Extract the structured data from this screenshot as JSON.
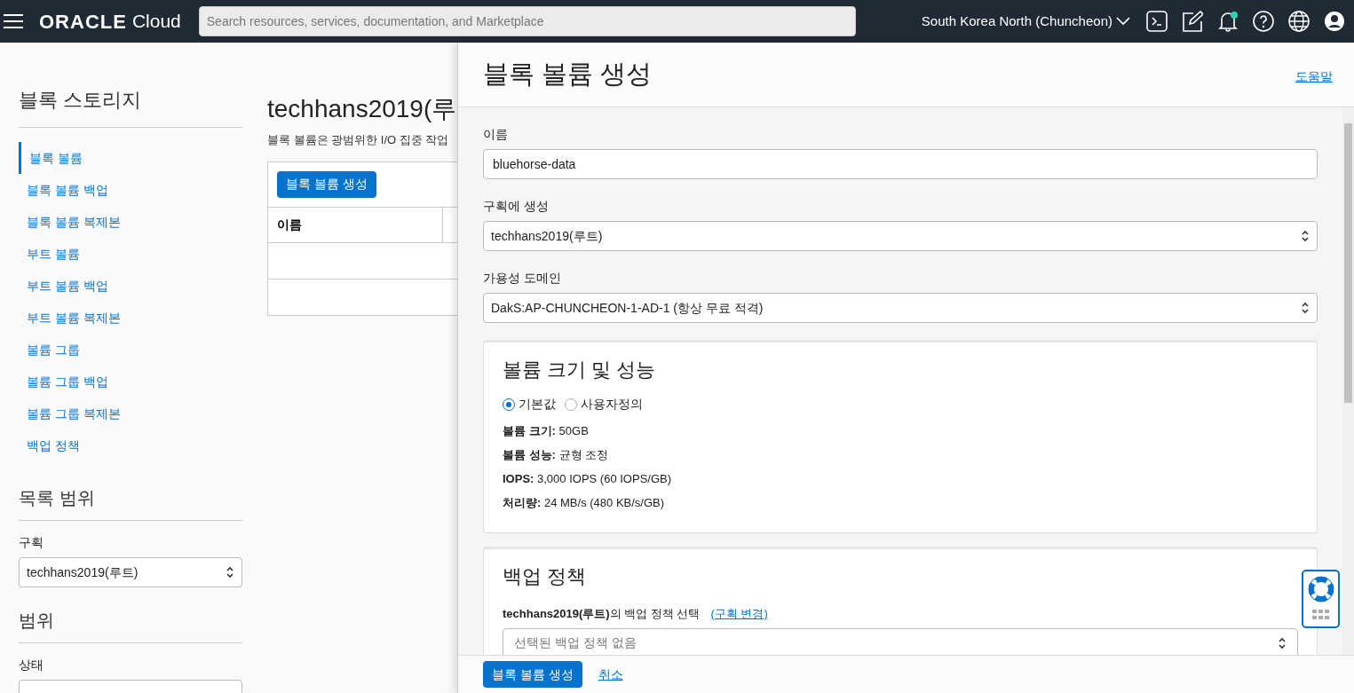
{
  "header": {
    "brand": "ORACLE",
    "product": "Cloud",
    "search": {
      "placeholder": "Search resources, services, documentation, and Marketplace"
    },
    "region": "South Korea North (Chuncheon)",
    "notification_dot": true
  },
  "sidebar": {
    "title": "블록 스토리지",
    "items": [
      {
        "label": "블록 볼륨",
        "selected": true
      },
      {
        "label": "블록 볼륨 백업",
        "selected": false
      },
      {
        "label": "블록 볼륨 복제본",
        "selected": false
      },
      {
        "label": "부트 볼륨",
        "selected": false
      },
      {
        "label": "부트 볼륨 백업",
        "selected": false
      },
      {
        "label": "부트 볼륨 복제본",
        "selected": false
      },
      {
        "label": "볼륨 그룹",
        "selected": false
      },
      {
        "label": "볼륨 그룹 백업",
        "selected": false
      },
      {
        "label": "볼륨 그룹 복제본",
        "selected": false
      },
      {
        "label": "백업 정책",
        "selected": false
      }
    ],
    "scope_title": "목록 범위",
    "compartment_label": "구획",
    "compartment_value": "techhans2019(루트)",
    "filter_title": "범위",
    "state_label": "상태"
  },
  "main": {
    "title": "techhans2019(루",
    "description": "블록 볼륨은 광범위한 I/O 집중 작업",
    "create_button": "블록 볼륨 생성",
    "table": {
      "columns": [
        "이름"
      ]
    }
  },
  "panel": {
    "title": "블록 볼륨 생성",
    "help_link": "도움말",
    "name_label": "이름",
    "name_value": "bluehorse-data",
    "compartment_label": "구획에 생성",
    "compartment_value": "techhans2019(루트)",
    "ad_label": "가용성 도메인",
    "ad_value": "DakS:AP-CHUNCHEON-1-AD-1 (항상 무료 적격)",
    "size_section": {
      "title": "볼륨 크기 및 성능",
      "options": [
        {
          "label": "기본값",
          "selected": true
        },
        {
          "label": "사용자정의",
          "selected": false
        }
      ],
      "details": [
        "**볼륨 크기:** 50GB",
        "**볼륨 성능:** 균형 조정",
        "**IOPS:** 3,000 IOPS (60 IOPS/GB)",
        "**처리량:** 24 MB/s (480 KB/s/GB)"
      ]
    },
    "backup_section": {
      "title": "백업 정책",
      "prompt": "**techhans2019(루트)**의 백업 정책 선택",
      "change_link": "(구획 변경)",
      "select_placeholder": "선택된 백업 정책 없음"
    },
    "submit_button": "블록 볼륨 생성",
    "cancel_link": "취소"
  }
}
